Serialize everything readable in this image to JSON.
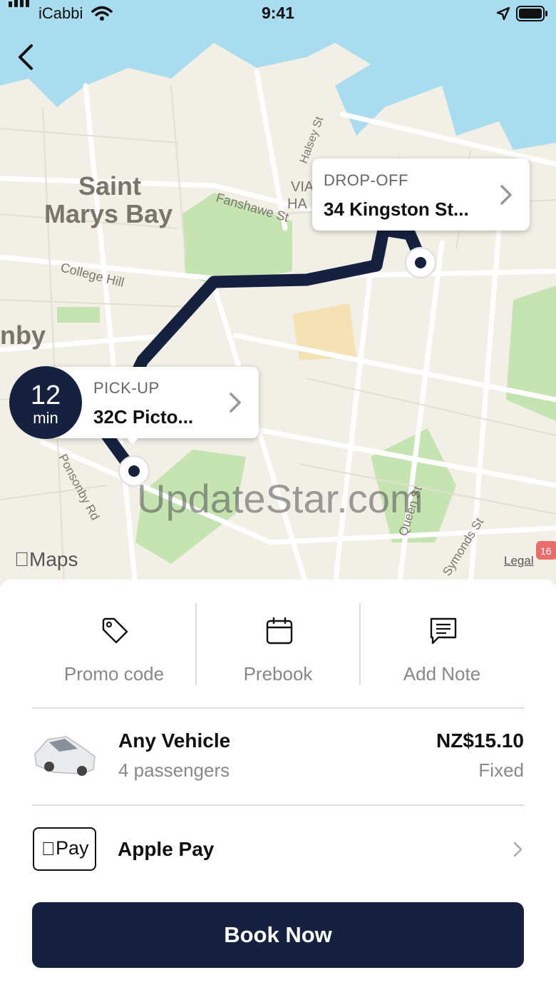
{
  "status_bar": {
    "carrier": "iCabbi",
    "time": "9:41"
  },
  "map": {
    "labels": [
      "Saint",
      "Marys Bay",
      "College Hill",
      "Fanshawe St",
      "Halsey St",
      "Ponsonby Rd",
      "Queen St",
      "Symonds St",
      "nby",
      "VIA",
      "HA",
      "16"
    ],
    "maps_logo": "Maps",
    "legal": "Legal",
    "watermark": "UpdateStar.com"
  },
  "dropoff": {
    "label": "DROP-OFF",
    "address": "34 Kingston St..."
  },
  "pickup": {
    "label": "PICK-UP",
    "address": "32C Picto...",
    "eta_value": "12",
    "eta_unit": "min"
  },
  "options": [
    {
      "label": "Promo code",
      "icon": "tag-icon"
    },
    {
      "label": "Prebook",
      "icon": "calendar-icon"
    },
    {
      "label": "Add Note",
      "icon": "note-icon"
    }
  ],
  "vehicle": {
    "name": "Any Vehicle",
    "capacity": "4 passengers",
    "price": "NZ$15.10",
    "price_type": "Fixed"
  },
  "payment": {
    "badge": "Pay",
    "method": "Apple Pay"
  },
  "book_button": "Book Now",
  "colors": {
    "navy": "#15213f",
    "water": "#a9dcef",
    "land": "#f2efe6",
    "park": "#c6e4b2"
  }
}
